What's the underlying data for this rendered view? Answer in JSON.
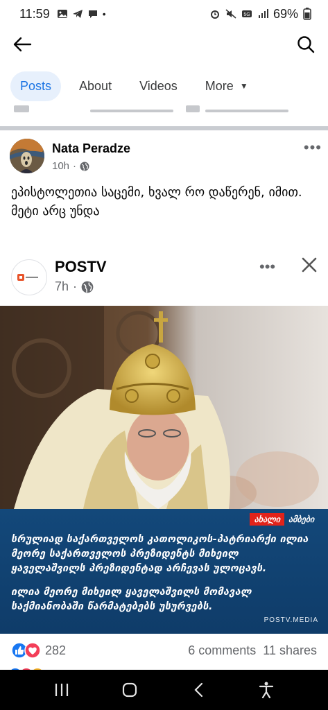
{
  "status_bar": {
    "time": "11:59",
    "left_icons": [
      "gallery-icon",
      "telegram-icon",
      "chat-icon"
    ],
    "dot": "•",
    "right_icons": [
      "alarm-icon",
      "mute-icon",
      "5g-icon",
      "signal-icon"
    ],
    "battery": "69%"
  },
  "topbar": {
    "back_icon": "arrow-left-icon",
    "search_icon": "search-icon"
  },
  "tabs": [
    {
      "label": "Posts",
      "active": true
    },
    {
      "label": "About",
      "active": false
    },
    {
      "label": "Videos",
      "active": false
    },
    {
      "label": "More",
      "active": false
    }
  ],
  "post": {
    "author": "Nata Peradze",
    "time": "10h",
    "audience_icon": "globe-icon",
    "text_line1": "ეპისტოლეთია საცემი, ხვალ რო დაწერენ, იმით.",
    "text_line2": "მეტი არც უნდა"
  },
  "shared_post": {
    "page_name": "POSTV",
    "time": "7h",
    "audience_icon": "globe-icon",
    "banner": {
      "tag_new": "ახალი",
      "tag_label": "ამბები",
      "headline": "სრულიად საქართველოს კათოლიკოს-პატრიარქი ილია მეორე საქართველოს პრეზიდენტს მიხეილ ყაველაშვილს პრეზიდენტად არჩევას ულოცავს.",
      "subline": "ილია მეორე მიხეილ ყაველაშვილს მომავალ საქმიანობაში წარმატებებს უსურვებს.",
      "source": "POSTV.MEDIA"
    }
  },
  "reactions": {
    "icons": [
      "like-icon",
      "love-icon"
    ],
    "count": "282",
    "comments": "6 comments",
    "shares": "11 shares"
  },
  "colors": {
    "accent": "#1b74e4",
    "banner": "#13487a",
    "news_red": "#e2231a"
  },
  "navbar": {
    "icons": [
      "recent-apps-icon",
      "home-icon",
      "back-icon",
      "accessibility-icon"
    ]
  }
}
